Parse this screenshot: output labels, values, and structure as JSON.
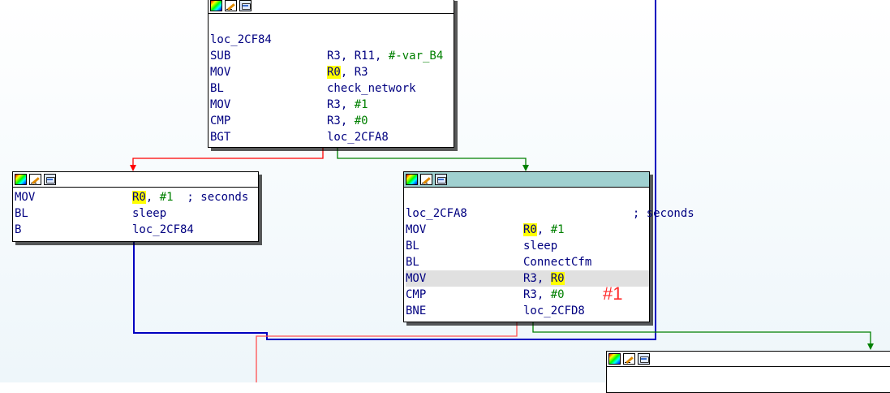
{
  "nodes": {
    "top": {
      "rows": [
        {
          "m": "",
          "o": ""
        },
        {
          "m": "loc_2CF84",
          "o": ""
        },
        {
          "m": "SUB",
          "o_parts": [
            {
              "t": "R3, R11, "
            },
            {
              "t": "#-var_B4",
              "cls": "num"
            }
          ]
        },
        {
          "m": "MOV",
          "o_parts": [
            {
              "t": "R0",
              "cls": "reg"
            },
            {
              "t": ", R3"
            }
          ]
        },
        {
          "m": "BL",
          "o_parts": [
            {
              "t": "check_network"
            }
          ]
        },
        {
          "m": "MOV",
          "o_parts": [
            {
              "t": "R3, "
            },
            {
              "t": "#1",
              "cls": "num"
            }
          ]
        },
        {
          "m": "CMP",
          "o_parts": [
            {
              "t": "R3, "
            },
            {
              "t": "#0",
              "cls": "num"
            }
          ]
        },
        {
          "m": "BGT",
          "o_parts": [
            {
              "t": "loc_2CFA8"
            }
          ]
        }
      ]
    },
    "left": {
      "rows": [
        {
          "m": "MOV",
          "o_parts": [
            {
              "t": "R0",
              "cls": "reg"
            },
            {
              "t": ", "
            },
            {
              "t": "#1",
              "cls": "num"
            },
            {
              "t": "  ; seconds",
              "cls": "cmt"
            }
          ]
        },
        {
          "m": "BL",
          "o_parts": [
            {
              "t": "sleep"
            }
          ]
        },
        {
          "m": "B",
          "o_parts": [
            {
              "t": "loc_2CF84"
            }
          ]
        }
      ]
    },
    "right": {
      "rows": [
        {
          "m": "",
          "o": ""
        },
        {
          "m": "loc_2CFA8",
          "o_parts": [
            {
              "t": "                ; seconds",
              "cls": "cmt"
            }
          ]
        },
        {
          "m": "MOV",
          "o_parts": [
            {
              "t": "R0",
              "cls": "reg"
            },
            {
              "t": ", "
            },
            {
              "t": "#1",
              "cls": "num"
            }
          ]
        },
        {
          "m": "BL",
          "o_parts": [
            {
              "t": "sleep"
            }
          ]
        },
        {
          "m": "BL",
          "o_parts": [
            {
              "t": "ConnectCfm"
            }
          ]
        },
        {
          "m": "MOV",
          "o_parts": [
            {
              "t": "R3, "
            },
            {
              "t": "R0",
              "cls": "reg"
            }
          ],
          "highlight": true
        },
        {
          "m": "CMP",
          "o_parts": [
            {
              "t": "R3, "
            },
            {
              "t": "#0",
              "cls": "num"
            }
          ]
        },
        {
          "m": "BNE",
          "o_parts": [
            {
              "t": "loc_2CFD8"
            }
          ]
        }
      ]
    },
    "bottom": {
      "rows": []
    }
  },
  "annotation": {
    "label": "#1",
    "color": "#ff2a2a"
  },
  "colors": {
    "edge_true": "#008000",
    "edge_false": "#ff0000",
    "edge_jump": "#0000c0",
    "active_title": "#a0d0d0",
    "register_highlight": "#ffff00"
  },
  "icons": [
    "color-palette-icon",
    "edit-pencil-icon",
    "graph-view-icon"
  ]
}
